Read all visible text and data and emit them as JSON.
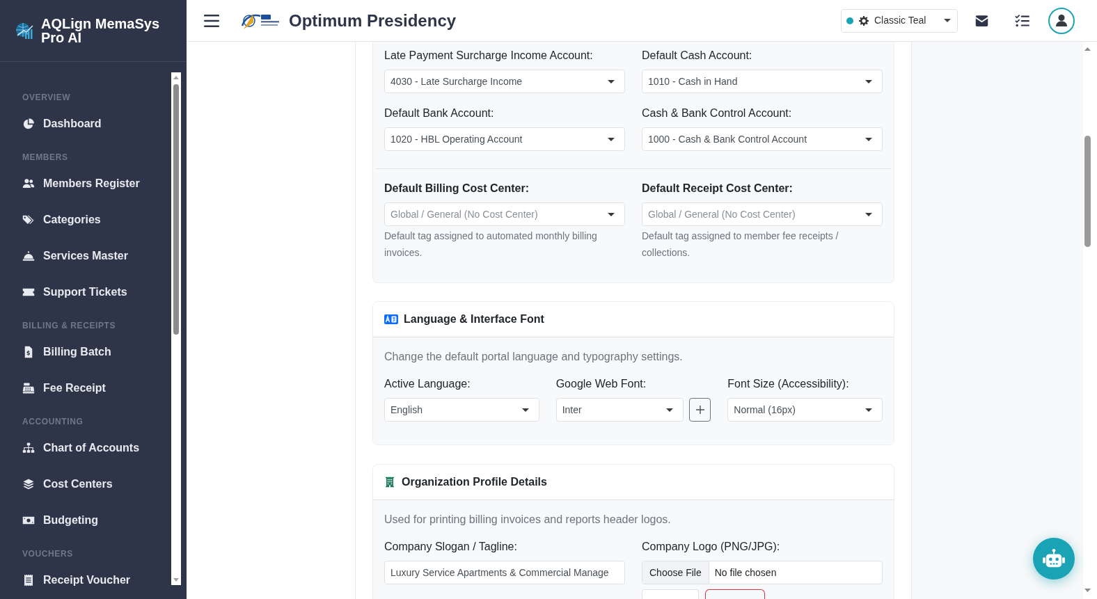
{
  "sidebar": {
    "brand": "AQLign MemaSys Pro AI",
    "sections": [
      {
        "title": "OVERVIEW",
        "items": [
          {
            "label": "Dashboard"
          }
        ]
      },
      {
        "title": "MEMBERS",
        "items": [
          {
            "label": "Members Register"
          },
          {
            "label": "Categories"
          },
          {
            "label": "Services Master"
          },
          {
            "label": "Support Tickets"
          }
        ]
      },
      {
        "title": "BILLING & RECEIPTS",
        "items": [
          {
            "label": "Billing Batch"
          },
          {
            "label": "Fee Receipt"
          }
        ]
      },
      {
        "title": "ACCOUNTING",
        "items": [
          {
            "label": "Chart of Accounts"
          },
          {
            "label": "Cost Centers"
          },
          {
            "label": "Budgeting"
          }
        ]
      },
      {
        "title": "VOUCHERS",
        "items": [
          {
            "label": "Receipt Voucher"
          }
        ]
      }
    ]
  },
  "topbar": {
    "title": "Optimum Presidency",
    "theme": "Classic Teal"
  },
  "finance_card": {
    "accounts": [
      {
        "label": "Late Payment Surcharge Income Account:",
        "value": "4030 - Late Surcharge Income"
      },
      {
        "label": "Default Cash Account:",
        "value": "1010 - Cash in Hand"
      },
      {
        "label": "Default Bank Account:",
        "value": "1020 - HBL Operating Account"
      },
      {
        "label": "Cash & Bank Control Account:",
        "value": "1000 - Cash & Bank Control Account"
      }
    ],
    "cost_centers": [
      {
        "label": "Default Billing Cost Center:",
        "placeholder": "Global / General (No Cost Center)",
        "help": "Default tag assigned to automated monthly billing invoices."
      },
      {
        "label": "Default Receipt Cost Center:",
        "placeholder": "Global / General (No Cost Center)",
        "help": "Default tag assigned to member fee receipts / collections."
      }
    ]
  },
  "language_card": {
    "title": "Language & Interface Font",
    "description": "Change the default portal language and typography settings.",
    "fields": [
      {
        "kind": "select",
        "label": "Active Language:",
        "value": "English"
      },
      {
        "kind": "select_add",
        "label": "Google Web Font:",
        "value": "Inter"
      },
      {
        "kind": "select",
        "label": "Font Size (Accessibility):",
        "value": "Normal (16px)"
      }
    ]
  },
  "organization_card": {
    "title": "Organization Profile Details",
    "description": "Used for printing billing invoices and reports header logos.",
    "slogan": {
      "label": "Company Slogan / Tagline:",
      "value": "Luxury Service Apartments & Commercial Manage"
    },
    "logo": {
      "label": "Company Logo (PNG/JPG):",
      "button": "Choose File",
      "status": "No file chosen"
    }
  }
}
